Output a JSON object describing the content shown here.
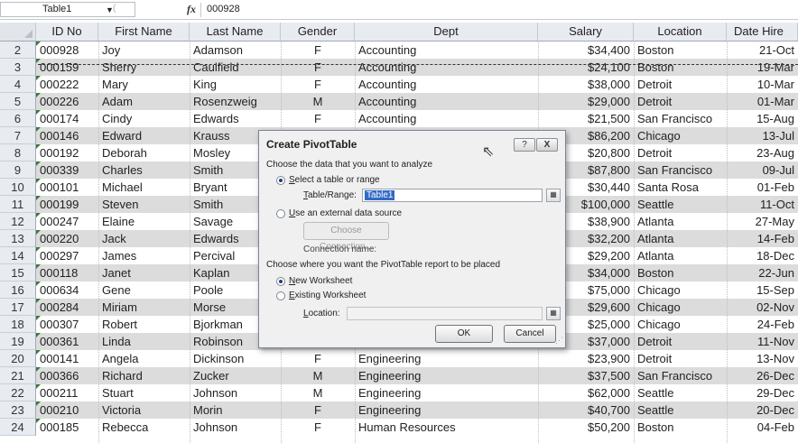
{
  "formula_bar": {
    "name_box": "Table1",
    "fx_label": "fx",
    "formula": "000928"
  },
  "columns": [
    "ID No",
    "First Name",
    "Last Name",
    "Gender",
    "Dept",
    "Salary",
    "Location",
    "Date Hire"
  ],
  "rows": [
    {
      "n": "2",
      "id": "000928",
      "first": "Joy",
      "last": "Adamson",
      "gender": "F",
      "dept": "Accounting",
      "salary": "$34,400",
      "loc": "Boston",
      "date": "21-Oct"
    },
    {
      "n": "3",
      "id": "000159",
      "first": "Sherry",
      "last": "Caulfield",
      "gender": "F",
      "dept": "Accounting",
      "salary": "$24,100",
      "loc": "Boston",
      "date": "19-Mar"
    },
    {
      "n": "4",
      "id": "000222",
      "first": "Mary",
      "last": "King",
      "gender": "F",
      "dept": "Accounting",
      "salary": "$38,000",
      "loc": "Detroit",
      "date": "10-Mar"
    },
    {
      "n": "5",
      "id": "000226",
      "first": "Adam",
      "last": "Rosenzweig",
      "gender": "M",
      "dept": "Accounting",
      "salary": "$29,000",
      "loc": "Detroit",
      "date": "01-Mar"
    },
    {
      "n": "6",
      "id": "000174",
      "first": "Cindy",
      "last": "Edwards",
      "gender": "F",
      "dept": "Accounting",
      "salary": "$21,500",
      "loc": "San Francisco",
      "date": "15-Aug"
    },
    {
      "n": "7",
      "id": "000146",
      "first": "Edward",
      "last": "Krauss",
      "gender": "",
      "dept": "",
      "salary": "$86,200",
      "loc": "Chicago",
      "date": "13-Jul"
    },
    {
      "n": "8",
      "id": "000192",
      "first": "Deborah",
      "last": "Mosley",
      "gender": "",
      "dept": "",
      "salary": "$20,800",
      "loc": "Detroit",
      "date": "23-Aug"
    },
    {
      "n": "9",
      "id": "000339",
      "first": "Charles",
      "last": "Smith",
      "gender": "",
      "dept": "",
      "salary": "$87,800",
      "loc": "San Francisco",
      "date": "09-Jul"
    },
    {
      "n": "10",
      "id": "000101",
      "first": "Michael",
      "last": "Bryant",
      "gender": "",
      "dept": "",
      "salary": "$30,440",
      "loc": "Santa Rosa",
      "date": "01-Feb"
    },
    {
      "n": "11",
      "id": "000199",
      "first": "Steven",
      "last": "Smith",
      "gender": "",
      "dept": "",
      "salary": "$100,000",
      "loc": "Seattle",
      "date": "11-Oct"
    },
    {
      "n": "12",
      "id": "000247",
      "first": "Elaine",
      "last": "Savage",
      "gender": "",
      "dept": "",
      "salary": "$38,900",
      "loc": "Atlanta",
      "date": "27-May"
    },
    {
      "n": "13",
      "id": "000220",
      "first": "Jack",
      "last": "Edwards",
      "gender": "",
      "dept": "",
      "salary": "$32,200",
      "loc": "Atlanta",
      "date": "14-Feb"
    },
    {
      "n": "14",
      "id": "000297",
      "first": "James",
      "last": "Percival",
      "gender": "",
      "dept": "",
      "salary": "$29,200",
      "loc": "Atlanta",
      "date": "18-Dec"
    },
    {
      "n": "15",
      "id": "000118",
      "first": "Janet",
      "last": "Kaplan",
      "gender": "",
      "dept": "",
      "salary": "$34,000",
      "loc": "Boston",
      "date": "22-Jun"
    },
    {
      "n": "16",
      "id": "000634",
      "first": "Gene",
      "last": "Poole",
      "gender": "",
      "dept": "",
      "salary": "$75,000",
      "loc": "Chicago",
      "date": "15-Sep"
    },
    {
      "n": "17",
      "id": "000284",
      "first": "Miriam",
      "last": "Morse",
      "gender": "",
      "dept": "",
      "salary": "$29,600",
      "loc": "Chicago",
      "date": "02-Nov"
    },
    {
      "n": "18",
      "id": "000307",
      "first": "Robert",
      "last": "Bjorkman",
      "gender": "",
      "dept": "",
      "salary": "$25,000",
      "loc": "Chicago",
      "date": "24-Feb"
    },
    {
      "n": "19",
      "id": "000361",
      "first": "Linda",
      "last": "Robinson",
      "gender": "",
      "dept": "",
      "salary": "$37,000",
      "loc": "Detroit",
      "date": "11-Nov"
    },
    {
      "n": "20",
      "id": "000141",
      "first": "Angela",
      "last": "Dickinson",
      "gender": "F",
      "dept": "Engineering",
      "salary": "$23,900",
      "loc": "Detroit",
      "date": "13-Nov"
    },
    {
      "n": "21",
      "id": "000366",
      "first": "Richard",
      "last": "Zucker",
      "gender": "M",
      "dept": "Engineering",
      "salary": "$37,500",
      "loc": "San Francisco",
      "date": "26-Dec"
    },
    {
      "n": "22",
      "id": "000211",
      "first": "Stuart",
      "last": "Johnson",
      "gender": "M",
      "dept": "Engineering",
      "salary": "$62,000",
      "loc": "Seattle",
      "date": "29-Dec"
    },
    {
      "n": "23",
      "id": "000210",
      "first": "Victoria",
      "last": "Morin",
      "gender": "F",
      "dept": "Engineering",
      "salary": "$40,700",
      "loc": "Seattle",
      "date": "20-Dec"
    },
    {
      "n": "24",
      "id": "000185",
      "first": "Rebecca",
      "last": "Johnson",
      "gender": "F",
      "dept": "Human Resources",
      "salary": "$50,200",
      "loc": "Boston",
      "date": "04-Feb"
    }
  ],
  "dialog": {
    "title": "Create PivotTable",
    "help": "?",
    "close": "X",
    "choose_data": "Choose the data that you want to analyze",
    "select_table_pre": "",
    "select_table_u": "S",
    "select_table_rest": "elect a table or range",
    "table_range_u": "T",
    "table_range_rest": "able/Range:",
    "table_range_value": "Table1",
    "external_u": "U",
    "external_rest": "se an external data source",
    "choose_connection": "Choose Connection...",
    "connection_name": "Connection name:",
    "choose_where": "Choose where you want the PivotTable report to be placed",
    "new_ws_u": "N",
    "new_ws_rest": "ew Worksheet",
    "existing_ws_u": "E",
    "existing_ws_rest": "xisting Worksheet",
    "location_u": "L",
    "location_rest": "ocation:",
    "location_value": "",
    "ok": "OK",
    "cancel": "Cancel"
  }
}
